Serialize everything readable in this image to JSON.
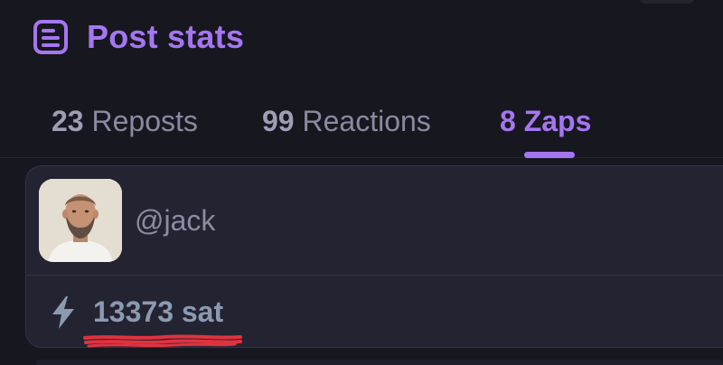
{
  "header": {
    "title": "Post stats",
    "icon": "document-icon",
    "accent_color": "#a576f0"
  },
  "tabs": [
    {
      "count": "23",
      "label": "Reposts",
      "active": false
    },
    {
      "count": "99",
      "label": "Reactions",
      "active": false
    },
    {
      "count": "8",
      "label": "Zaps",
      "active": true
    }
  ],
  "zap": {
    "username": "@jack",
    "amount": "13373 sat",
    "icon": "lightning-icon"
  },
  "annotation": {
    "color": "#e0333f"
  }
}
